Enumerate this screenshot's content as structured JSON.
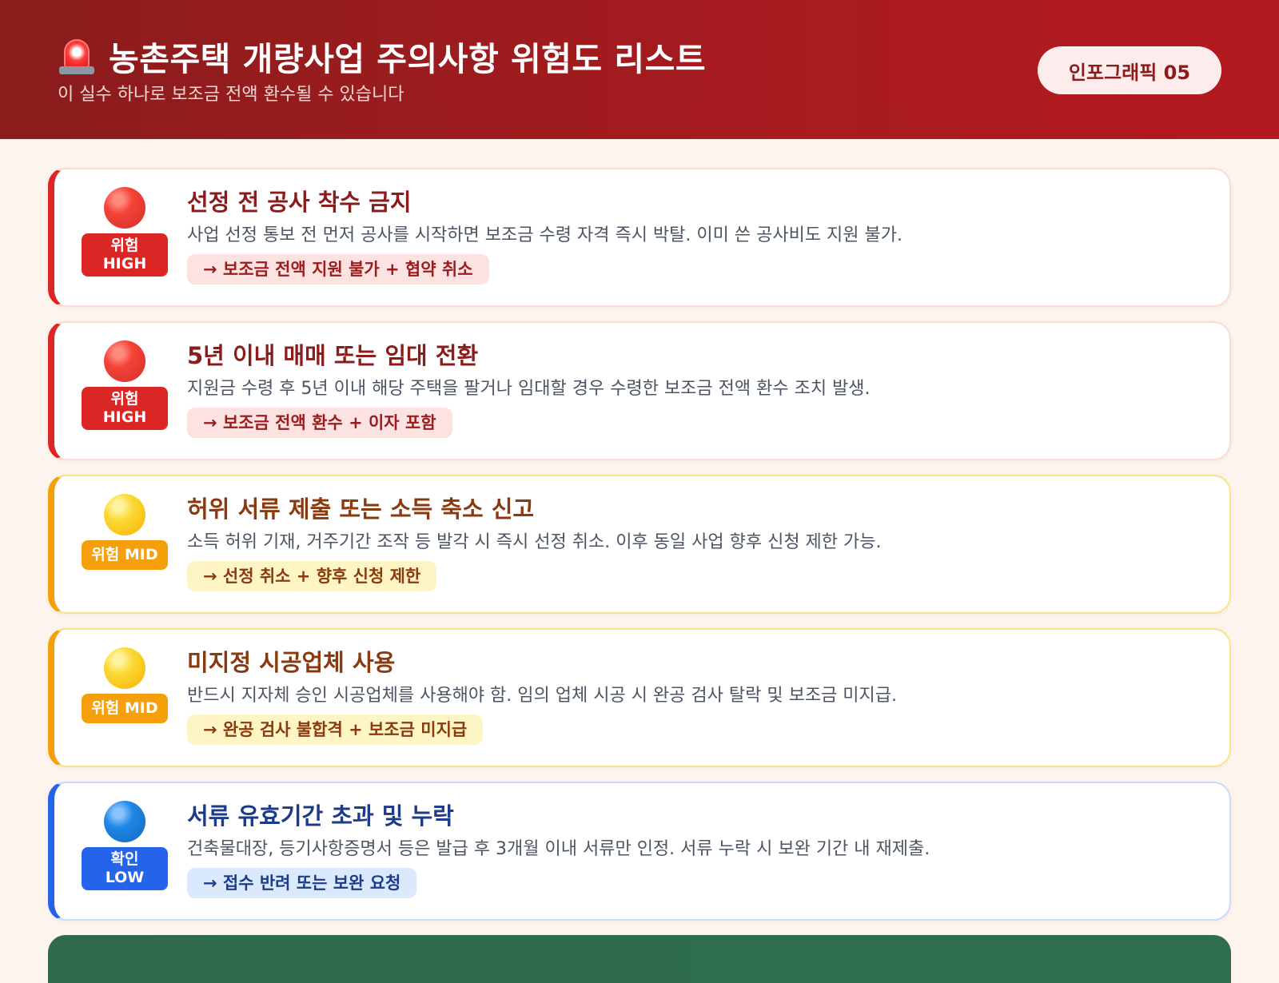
{
  "header": {
    "icon": "siren-icon",
    "title": "농촌주택 개량사업 주의사항 위험도 리스트",
    "subtitle": "이 실수 하나로 보조금 전액 환수될 수 있습니다",
    "badge": "인포그래픽 05"
  },
  "colors": {
    "header_bg": "#a51b1f",
    "high": "#dc2626",
    "mid": "#f5a00b",
    "low": "#2563eb",
    "footer": "#2f6b4b"
  },
  "items": [
    {
      "level": "high",
      "icon": "red-circle-icon",
      "badge_line1": "위험",
      "badge_line2": "HIGH",
      "title": "선정 전 공사 착수 금지",
      "description": "사업 선정 통보 전 먼저 공사를 시작하면 보조금 수령 자격 즉시 박탈. 이미 쓴 공사비도 지원 불가.",
      "result": "→ 보조금 전액 지원 불가 + 협약 취소"
    },
    {
      "level": "high",
      "icon": "red-circle-icon",
      "badge_line1": "위험",
      "badge_line2": "HIGH",
      "title": "5년 이내 매매 또는 임대 전환",
      "description": "지원금 수령 후 5년 이내 해당 주택을 팔거나 임대할 경우 수령한 보조금 전액 환수 조치 발생.",
      "result": "→ 보조금 전액 환수 + 이자 포함"
    },
    {
      "level": "mid",
      "icon": "yellow-circle-icon",
      "badge_line1": "위험 MID",
      "badge_line2": "",
      "title": "허위 서류 제출 또는 소득 축소 신고",
      "description": "소득 허위 기재, 거주기간 조작 등 발각 시 즉시 선정 취소. 이후 동일 사업 향후 신청 제한 가능.",
      "result": "→ 선정 취소 + 향후 신청 제한"
    },
    {
      "level": "mid",
      "icon": "yellow-circle-icon",
      "badge_line1": "위험 MID",
      "badge_line2": "",
      "title": "미지정 시공업체 사용",
      "description": "반드시 지자체 승인 시공업체를 사용해야 함. 임의 업체 시공 시 완공 검사 탈락 및 보조금 미지급.",
      "result": "→ 완공 검사 불합격 + 보조금 미지급"
    },
    {
      "level": "low",
      "icon": "blue-circle-icon",
      "badge_line1": "확인",
      "badge_line2": "LOW",
      "title": "서류 유효기간 초과 및 누락",
      "description": "건축물대장, 등기사항증명서 등은 발급 후 3개월 이내 서류만 인정. 서류 누락 시 보완 기간 내 재제출.",
      "result": "→ 접수 반려 또는 보완 요청"
    }
  ]
}
